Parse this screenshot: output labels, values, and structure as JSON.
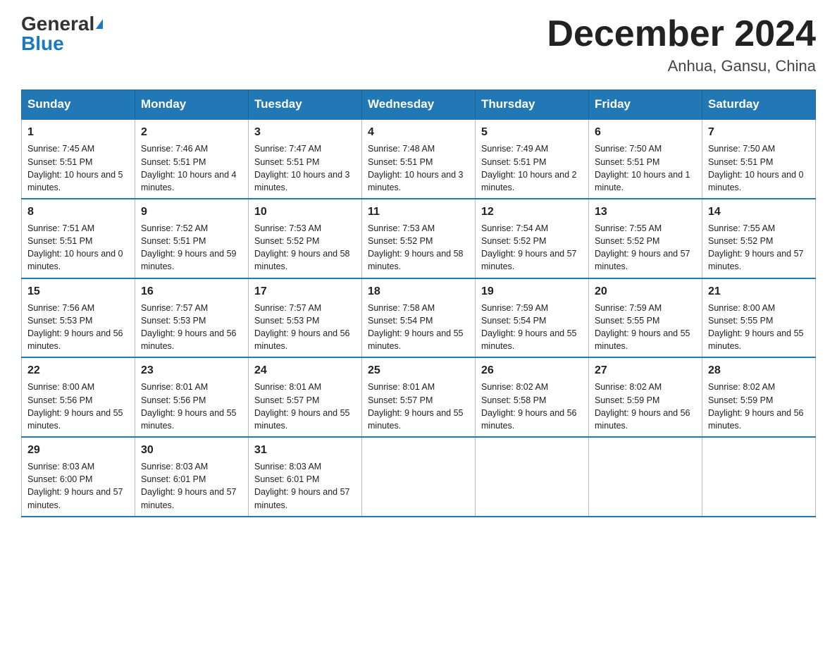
{
  "header": {
    "logo_general": "General",
    "logo_blue": "Blue",
    "month_title": "December 2024",
    "location": "Anhua, Gansu, China"
  },
  "days_of_week": [
    "Sunday",
    "Monday",
    "Tuesday",
    "Wednesday",
    "Thursday",
    "Friday",
    "Saturday"
  ],
  "weeks": [
    [
      {
        "day": "1",
        "sunrise": "7:45 AM",
        "sunset": "5:51 PM",
        "daylight": "10 hours and 5 minutes."
      },
      {
        "day": "2",
        "sunrise": "7:46 AM",
        "sunset": "5:51 PM",
        "daylight": "10 hours and 4 minutes."
      },
      {
        "day": "3",
        "sunrise": "7:47 AM",
        "sunset": "5:51 PM",
        "daylight": "10 hours and 3 minutes."
      },
      {
        "day": "4",
        "sunrise": "7:48 AM",
        "sunset": "5:51 PM",
        "daylight": "10 hours and 3 minutes."
      },
      {
        "day": "5",
        "sunrise": "7:49 AM",
        "sunset": "5:51 PM",
        "daylight": "10 hours and 2 minutes."
      },
      {
        "day": "6",
        "sunrise": "7:50 AM",
        "sunset": "5:51 PM",
        "daylight": "10 hours and 1 minute."
      },
      {
        "day": "7",
        "sunrise": "7:50 AM",
        "sunset": "5:51 PM",
        "daylight": "10 hours and 0 minutes."
      }
    ],
    [
      {
        "day": "8",
        "sunrise": "7:51 AM",
        "sunset": "5:51 PM",
        "daylight": "10 hours and 0 minutes."
      },
      {
        "day": "9",
        "sunrise": "7:52 AM",
        "sunset": "5:51 PM",
        "daylight": "9 hours and 59 minutes."
      },
      {
        "day": "10",
        "sunrise": "7:53 AM",
        "sunset": "5:52 PM",
        "daylight": "9 hours and 58 minutes."
      },
      {
        "day": "11",
        "sunrise": "7:53 AM",
        "sunset": "5:52 PM",
        "daylight": "9 hours and 58 minutes."
      },
      {
        "day": "12",
        "sunrise": "7:54 AM",
        "sunset": "5:52 PM",
        "daylight": "9 hours and 57 minutes."
      },
      {
        "day": "13",
        "sunrise": "7:55 AM",
        "sunset": "5:52 PM",
        "daylight": "9 hours and 57 minutes."
      },
      {
        "day": "14",
        "sunrise": "7:55 AM",
        "sunset": "5:52 PM",
        "daylight": "9 hours and 57 minutes."
      }
    ],
    [
      {
        "day": "15",
        "sunrise": "7:56 AM",
        "sunset": "5:53 PM",
        "daylight": "9 hours and 56 minutes."
      },
      {
        "day": "16",
        "sunrise": "7:57 AM",
        "sunset": "5:53 PM",
        "daylight": "9 hours and 56 minutes."
      },
      {
        "day": "17",
        "sunrise": "7:57 AM",
        "sunset": "5:53 PM",
        "daylight": "9 hours and 56 minutes."
      },
      {
        "day": "18",
        "sunrise": "7:58 AM",
        "sunset": "5:54 PM",
        "daylight": "9 hours and 55 minutes."
      },
      {
        "day": "19",
        "sunrise": "7:59 AM",
        "sunset": "5:54 PM",
        "daylight": "9 hours and 55 minutes."
      },
      {
        "day": "20",
        "sunrise": "7:59 AM",
        "sunset": "5:55 PM",
        "daylight": "9 hours and 55 minutes."
      },
      {
        "day": "21",
        "sunrise": "8:00 AM",
        "sunset": "5:55 PM",
        "daylight": "9 hours and 55 minutes."
      }
    ],
    [
      {
        "day": "22",
        "sunrise": "8:00 AM",
        "sunset": "5:56 PM",
        "daylight": "9 hours and 55 minutes."
      },
      {
        "day": "23",
        "sunrise": "8:01 AM",
        "sunset": "5:56 PM",
        "daylight": "9 hours and 55 minutes."
      },
      {
        "day": "24",
        "sunrise": "8:01 AM",
        "sunset": "5:57 PM",
        "daylight": "9 hours and 55 minutes."
      },
      {
        "day": "25",
        "sunrise": "8:01 AM",
        "sunset": "5:57 PM",
        "daylight": "9 hours and 55 minutes."
      },
      {
        "day": "26",
        "sunrise": "8:02 AM",
        "sunset": "5:58 PM",
        "daylight": "9 hours and 56 minutes."
      },
      {
        "day": "27",
        "sunrise": "8:02 AM",
        "sunset": "5:59 PM",
        "daylight": "9 hours and 56 minutes."
      },
      {
        "day": "28",
        "sunrise": "8:02 AM",
        "sunset": "5:59 PM",
        "daylight": "9 hours and 56 minutes."
      }
    ],
    [
      {
        "day": "29",
        "sunrise": "8:03 AM",
        "sunset": "6:00 PM",
        "daylight": "9 hours and 57 minutes."
      },
      {
        "day": "30",
        "sunrise": "8:03 AM",
        "sunset": "6:01 PM",
        "daylight": "9 hours and 57 minutes."
      },
      {
        "day": "31",
        "sunrise": "8:03 AM",
        "sunset": "6:01 PM",
        "daylight": "9 hours and 57 minutes."
      },
      null,
      null,
      null,
      null
    ]
  ]
}
